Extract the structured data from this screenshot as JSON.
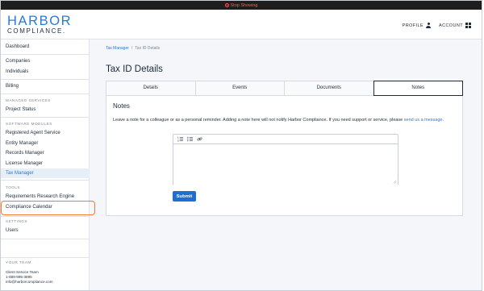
{
  "recording_bar": {
    "label": "Stop Showing"
  },
  "header": {
    "logo_top": "HARBOR",
    "logo_bottom": "COMPLIANCE.",
    "profile_label": "PROFILE",
    "account_label": "ACCOUNT"
  },
  "sidebar": {
    "items": {
      "dashboard": "Dashboard",
      "companies": "Companies",
      "individuals": "Individuals",
      "billing": "Billing",
      "project_status": "Project Status",
      "registered_agent": "Registered Agent Service",
      "entity_manager": "Entity Manager",
      "records_manager": "Records Manager",
      "license_manager": "License Manager",
      "tax_manager": "Tax Manager",
      "requirements_engine": "Requirements Research Engine",
      "compliance_calendar": "Compliance Calendar",
      "users": "Users"
    },
    "sections": {
      "managed_services": "MANAGED SERVICES",
      "software_modules": "SOFTWARE MODULES",
      "tools": "TOOLS",
      "settings": "SETTINGS"
    },
    "team": {
      "label": "YOUR TEAM",
      "name": "Client Service Team",
      "phone": "1-888-995-3895",
      "email": "info@harborcompliance.com"
    }
  },
  "main": {
    "breadcrumb": {
      "parent": "Tax Manager",
      "separator": "/",
      "current": "Tax ID Details"
    },
    "title": "Tax ID Details",
    "tabs": {
      "details": "Details",
      "events": "Events",
      "documents": "Documents",
      "notes": "Notes"
    },
    "notes": {
      "heading": "Notes",
      "description": "Leave a note for a colleague or as a personal reminder. Adding a note here will not notify Harbor Compliance. If you need support or service, please ",
      "link_text": "send us a message",
      "description_end": ".",
      "textarea_value": "",
      "submit_label": "Submit"
    }
  },
  "colors": {
    "brand_blue": "#2b7ad1",
    "button_blue": "#1d6fd1",
    "highlight_orange": "#f07b2e",
    "stop_red": "#ff5a4f"
  },
  "icons": {
    "ordered_list": "ordered-list-icon",
    "bullet_list": "bullet-list-icon",
    "link": "link-icon",
    "profile": "person-icon",
    "account": "grid-icon",
    "stop": "stop-record-icon"
  }
}
